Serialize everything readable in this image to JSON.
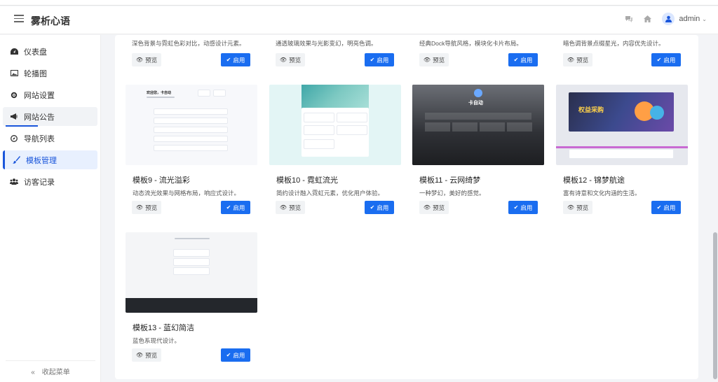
{
  "brand": "雾析心语",
  "header": {
    "user": "admin"
  },
  "sidebar": {
    "items": [
      {
        "label": "仪表盘",
        "icon": "dashboard-icon"
      },
      {
        "label": "轮播图",
        "icon": "image-icon"
      },
      {
        "label": "网站设置",
        "icon": "gear-icon"
      },
      {
        "label": "网站公告",
        "icon": "megaphone-icon"
      },
      {
        "label": "导航列表",
        "icon": "compass-icon"
      },
      {
        "label": "模板管理",
        "icon": "brush-icon"
      },
      {
        "label": "访客记录",
        "icon": "users-icon"
      }
    ],
    "collapse_label": "收起菜单"
  },
  "buttons": {
    "preview": "预览",
    "enable": "启用"
  },
  "top_row_descriptions": [
    "深色背景与霓虹色彩对比，动感设计元素。",
    "通透玻璃效果与光影变幻，明亮色调。",
    "经典Dock导航风格，模块化卡片布局。",
    "暗色调背景点缀星光，内容优先设计。"
  ],
  "templates": [
    {
      "title": "模板9 - 流光溢彩",
      "desc": "动态流光效果与网格布局，响应式设计。"
    },
    {
      "title": "模板10 - 霓虹流光",
      "desc": "简约设计融入霓虹元素，优化用户体验。"
    },
    {
      "title": "模板11 - 云网绮梦",
      "desc": "一种梦幻，美好的感觉。"
    },
    {
      "title": "模板12 - 锦梦航途",
      "desc": "富有诗意和文化内涵的生活。"
    },
    {
      "title": "模板13 - 蓝幻简洁",
      "desc": "蓝色系现代设计。"
    }
  ],
  "thumbnails": {
    "t9_heading": "欢迎您，卡自动",
    "t11_heading": "卡自动",
    "t12_banner": "权益采购"
  }
}
